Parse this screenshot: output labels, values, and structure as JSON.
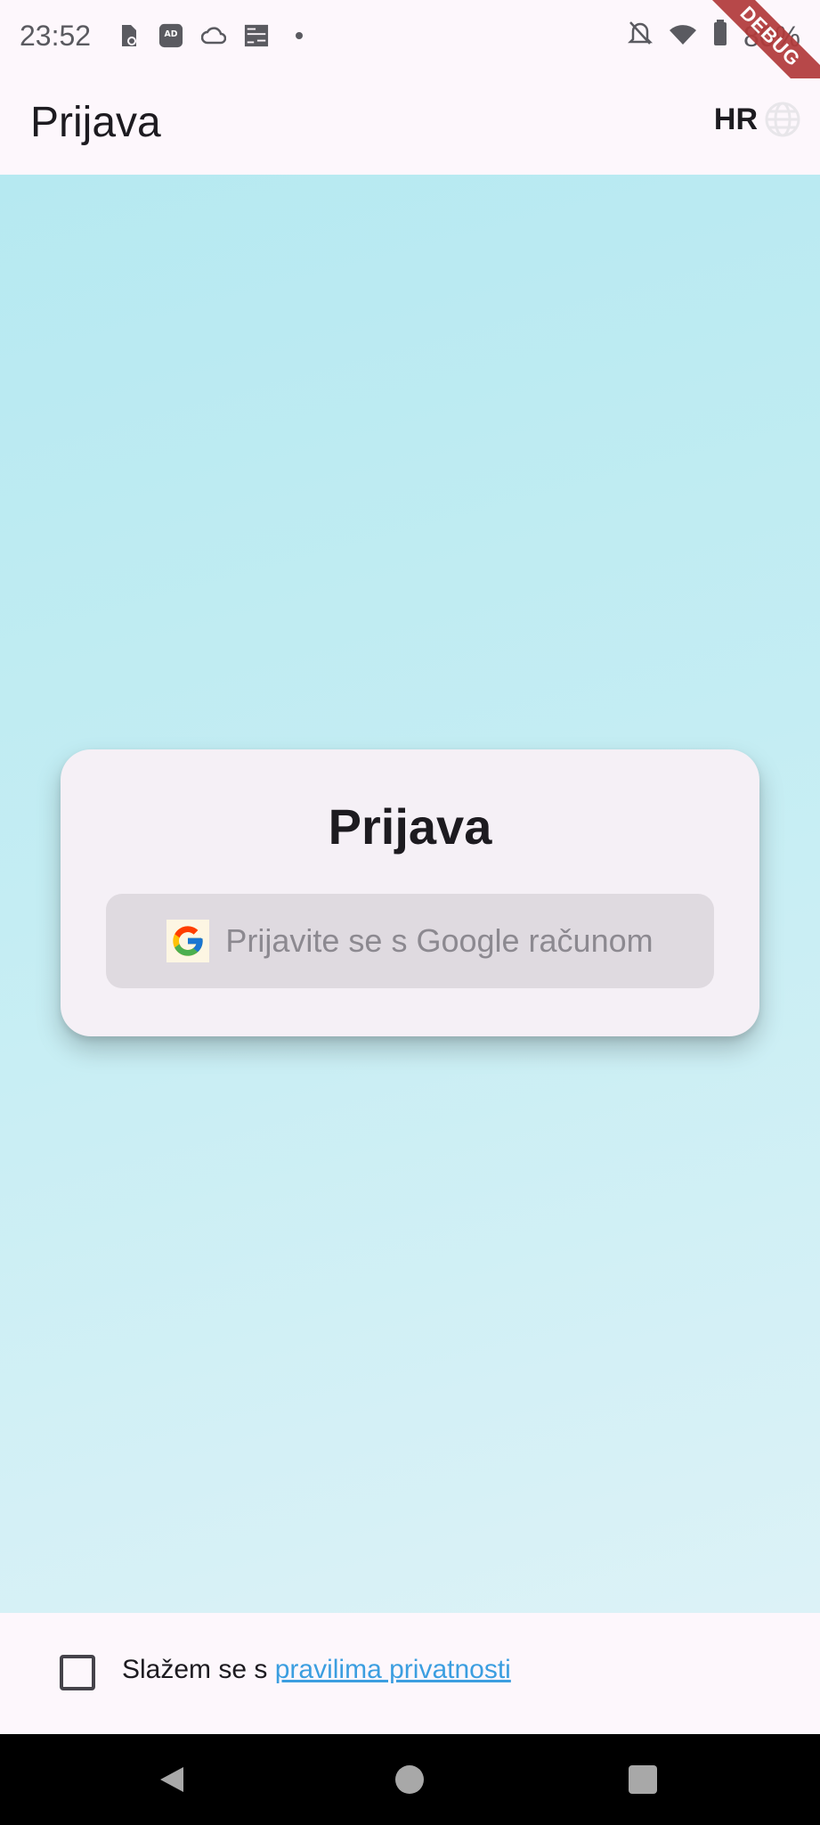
{
  "status_bar": {
    "time": "23:52",
    "battery": "80%",
    "left_icons": [
      "battery-saver-icon",
      "ad-blocker-icon",
      "cloud-icon",
      "photo-icon",
      "dot-icon"
    ],
    "right_icons": [
      "silent-bell-icon",
      "wifi-icon",
      "battery-icon"
    ],
    "debug_banner": "DEBUG"
  },
  "app_bar": {
    "title": "Prijava",
    "language_code": "HR"
  },
  "login_card": {
    "title": "Prijava",
    "google_button_label": "Prijavite se s Google računom"
  },
  "consent": {
    "text": "Slažem se s ",
    "link_text": "pravilima privatnosti",
    "checked": false
  },
  "colors": {
    "gradient_top": "#b6e9f1",
    "gradient_bottom": "#dcf2f7",
    "link": "#3b9ee0",
    "card": "#f5f0f6",
    "button": "#dfdae0"
  }
}
